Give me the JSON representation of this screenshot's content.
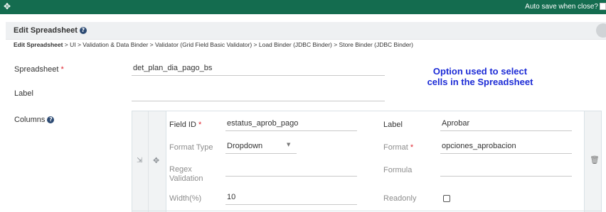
{
  "topbar": {
    "move_icon": "move-arrows-icon",
    "autosave_label": "Auto save when close?"
  },
  "panel": {
    "title": "Edit Spreadsheet",
    "help_icon": "?"
  },
  "breadcrumb": {
    "current": "Edit Spreadsheet",
    "trail": " > UI > Validation & Data Binder > Validator (Grid Field Basic Validator) > Load Binder (JDBC Binder) > Store Binder (JDBC Binder)"
  },
  "form": {
    "spreadsheet_label": "Spreadsheet",
    "spreadsheet_value": "det_plan_dia_pago_bs",
    "label_label": "Label",
    "label_value": "",
    "columns_label": "Columns",
    "required_mark": "*"
  },
  "note": {
    "line1": "Option used to select",
    "line2": "cells in the Spreadsheet"
  },
  "column_row": {
    "field_id_label": "Field ID",
    "field_id_value": "estatus_aprob_pago",
    "label_label": "Label",
    "label_value": "Aprobar",
    "format_type_label": "Format Type",
    "format_type_value": "Dropdown",
    "format_label": "Format",
    "format_value": "opciones_aprobacion",
    "regex_label_line1": "Regex",
    "regex_label_line2": "Validation",
    "regex_value": "",
    "formula_label": "Formula",
    "formula_value": "",
    "width_label": "Width(%)",
    "width_value": "10",
    "readonly_label": "Readonly",
    "readonly_checked": false
  }
}
